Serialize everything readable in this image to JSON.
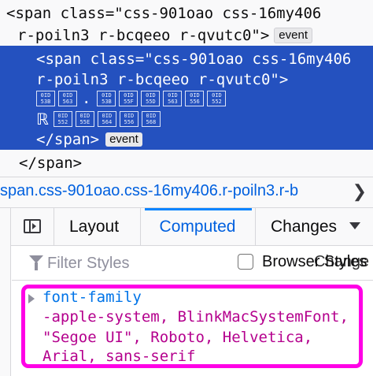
{
  "markup": {
    "line1": {
      "open": "<span class=\"css-901oao css-16my406",
      "cont": "r-poiln3 r-bcqeeo r-qvutc0\">",
      "badge": "event"
    },
    "selected": {
      "line1": "<span class=\"css-901oao css-16my406",
      "line2": "r-poiln3 r-bcqeeo r-qvutc0\">",
      "glyph_row1": [
        "0I D 53 B",
        "0I D 56 3",
        ".",
        "0I D 53 B",
        "0I D 55 F",
        "0I D 55 D",
        "0I D 56 3",
        "0I D 55 6",
        "0I D 55 2"
      ],
      "glyph_row2": [
        "ℝ",
        "0I D 55 2",
        "0I D 55 E",
        "0I D 56 4",
        "0I D 55 6",
        "0I D 56 8"
      ],
      "close": "</span>",
      "badge": "event"
    },
    "close_outer": "</span>"
  },
  "breadcrumb": {
    "text": "span.css-901oao.css-16my406.r-poiln3.r-b"
  },
  "tabs": {
    "layout": "Layout",
    "computed": "Computed",
    "changes": "Changes"
  },
  "filter": {
    "placeholder": "Filter Styles",
    "browser_styles": "Browser Styles",
    "overlap_text": "Change"
  },
  "computed": {
    "property": "font-family",
    "value_lines": [
      "-apple-system, BlinkMacSystemFont,",
      "\"Segoe UI\", Roboto, Helvetica,",
      "Arial, sans-serif"
    ]
  },
  "colors": {
    "selection": "#2451bf",
    "highlight": "#ff00e6",
    "property_name": "#0074e8",
    "property_value": "#b4008d",
    "link": "#0060df"
  }
}
